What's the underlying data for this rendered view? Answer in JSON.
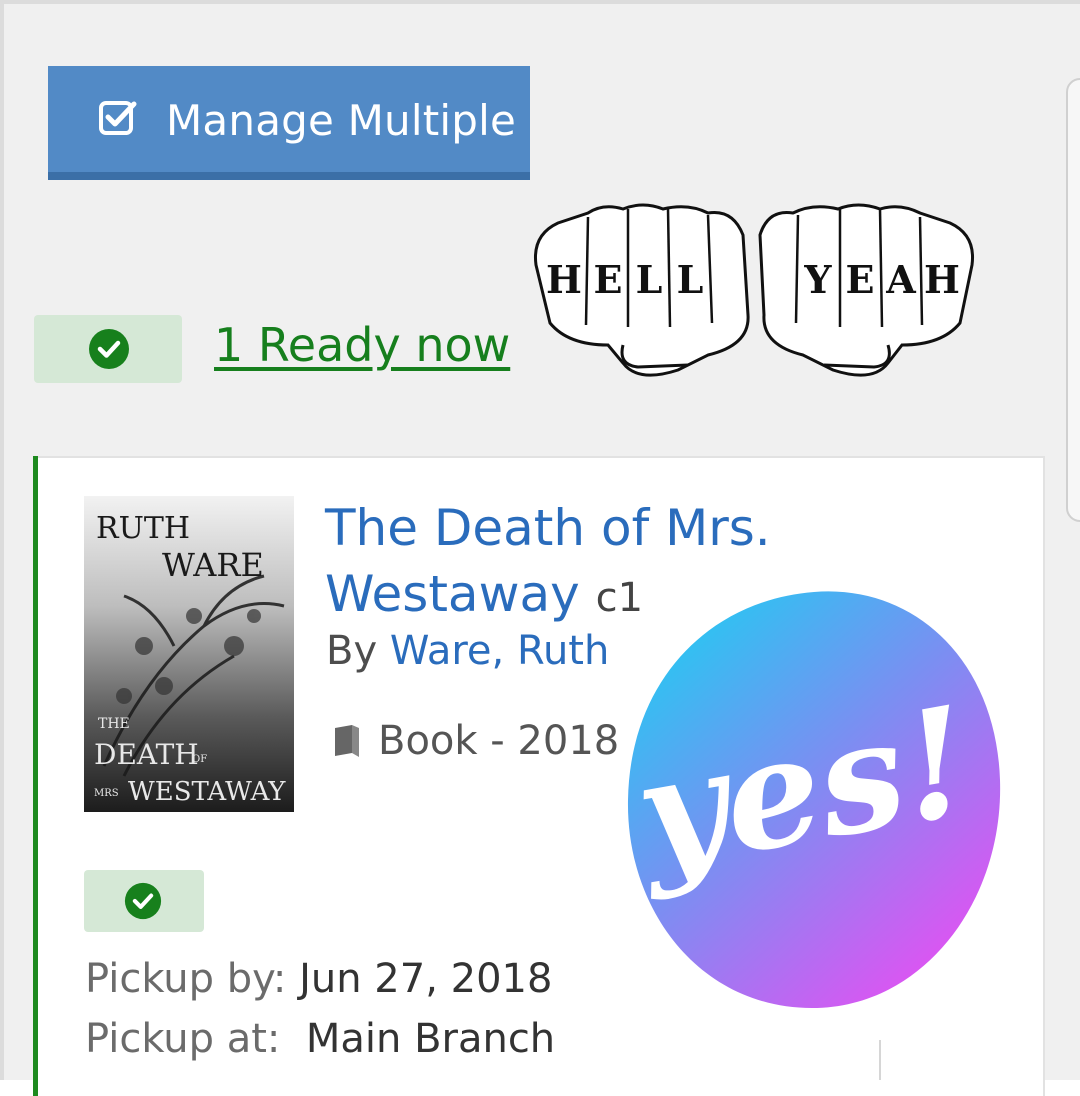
{
  "manage": {
    "label": "Manage Multiple",
    "icon": "checkbox-checked-icon"
  },
  "ready": {
    "link_text": "1 Ready now",
    "icon": "check-circle-icon",
    "color": "#167f1d"
  },
  "sticker_top": {
    "letters_left": "HELL",
    "letters_right": "YEAH"
  },
  "hold": {
    "cover": {
      "author_line1": "RUTH",
      "author_line2": "WARE",
      "title_line1": "THE",
      "title_line2": "DEATH",
      "title_of": "OF",
      "title_mrs": "MRS",
      "title_line3": "WESTAWAY"
    },
    "title": "The Death of Mrs. Westaway",
    "edition": "c1",
    "by_label": "By",
    "author": "Ware, Ruth",
    "format": "Book - 2018",
    "status_icon": "check-circle-icon",
    "pickup_by_label": "Pickup by:",
    "pickup_by_value": "Jun 27, 2018",
    "pickup_at_label": "Pickup at:",
    "pickup_at_value": "Main Branch"
  },
  "sticker_yes": {
    "text": "yes!"
  },
  "colors": {
    "accent_blue": "#528ac6",
    "link_blue": "#2a6cbc",
    "green": "#1e8a1f",
    "badge_green": "#d5e8d6"
  }
}
